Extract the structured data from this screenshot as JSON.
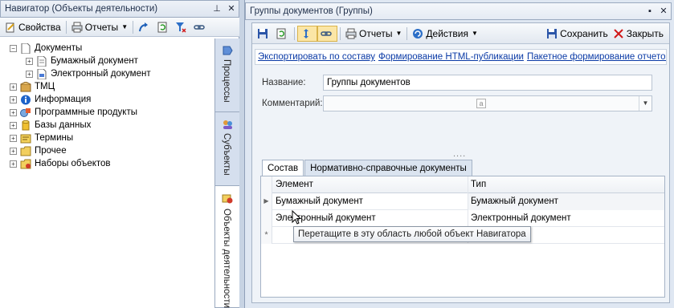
{
  "navigator": {
    "title": "Навигатор (Объекты деятельности)",
    "toolbar": {
      "properties_label": "Свойства",
      "reports_label": "Отчеты"
    },
    "tree": [
      {
        "label": "Документы",
        "level": 0,
        "expander": "−"
      },
      {
        "label": "Бумажный документ",
        "level": 1,
        "expander": "+"
      },
      {
        "label": "Электронный документ",
        "level": 1,
        "expander": "+"
      },
      {
        "label": "ТМЦ",
        "level": 0,
        "expander": "+"
      },
      {
        "label": "Информация",
        "level": 0,
        "expander": "+"
      },
      {
        "label": "Программные продукты",
        "level": 0,
        "expander": "+"
      },
      {
        "label": "Базы данных",
        "level": 0,
        "expander": "+"
      },
      {
        "label": "Термины",
        "level": 0,
        "expander": "+"
      },
      {
        "label": "Прочее",
        "level": 0,
        "expander": "+"
      },
      {
        "label": "Наборы объектов",
        "level": 0,
        "expander": "+"
      }
    ],
    "vertical_tabs": [
      "Процессы",
      "Субъекты",
      "Объекты деятельности"
    ]
  },
  "editor": {
    "title": "Группы документов (Группы)",
    "toolbar": {
      "reports_label": "Отчеты",
      "actions_label": "Действия",
      "save_label": "Сохранить",
      "close_label": "Закрыть"
    },
    "links": [
      "Экспортировать по составу",
      "Формирование HTML-публикации",
      "Пакетное формирование отчетов"
    ],
    "name_label": "Название:",
    "name_value": "Группы документов",
    "comment_label": "Комментарий:",
    "comment_value": "",
    "splitter_dots": "....",
    "tabs": [
      "Состав",
      "Нормативно-справочные документы"
    ],
    "grid": {
      "columns": [
        "Элемент",
        "Тип"
      ],
      "rows": [
        {
          "element": "Бумажный документ",
          "type": "Бумажный документ"
        },
        {
          "element": "Электронный документ",
          "type": "Электронный документ"
        }
      ],
      "new_row_marker": "*"
    },
    "tooltip": "Перетащите в эту область любой объект Навигатора"
  },
  "colors": {
    "accent": "#0a3aa6",
    "panel_bg": "#dfe7f2"
  }
}
